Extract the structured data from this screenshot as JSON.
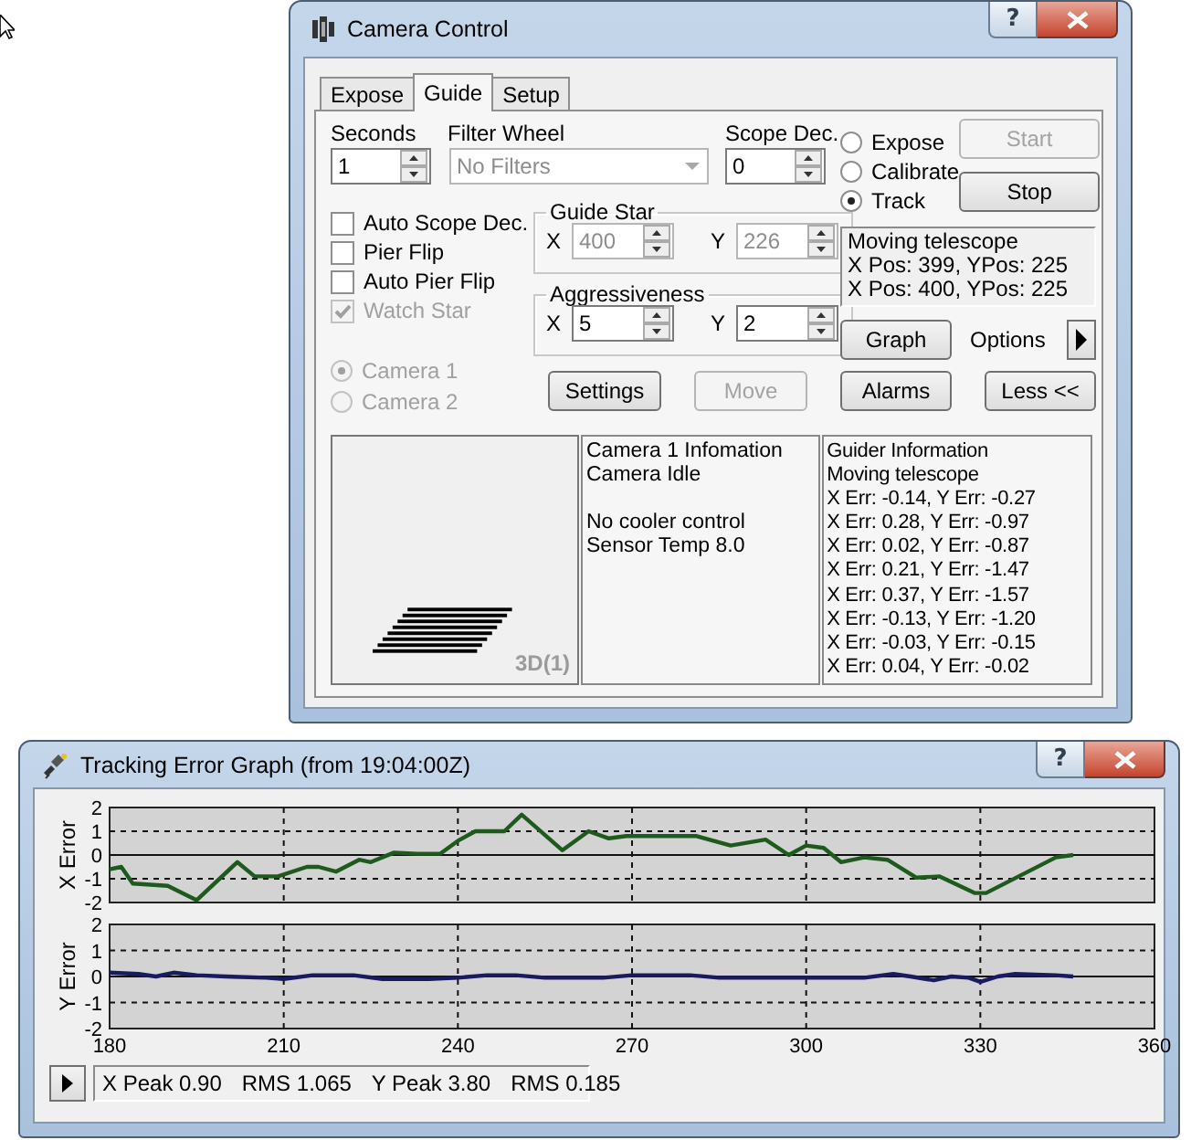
{
  "camera_window": {
    "title": "Camera Control",
    "help_button": "?",
    "tabs": [
      {
        "label": "Expose",
        "selected": false
      },
      {
        "label": "Guide",
        "selected": true
      },
      {
        "label": "Setup",
        "selected": false
      }
    ],
    "seconds": {
      "label": "Seconds",
      "value": "1"
    },
    "filter_wheel": {
      "label": "Filter Wheel",
      "value": "No Filters",
      "disabled": true
    },
    "scope_dec": {
      "label": "Scope Dec.",
      "value": "0"
    },
    "mode_options": [
      {
        "label": "Expose",
        "selected": false
      },
      {
        "label": "Calibrate",
        "selected": false
      },
      {
        "label": "Track",
        "selected": true
      }
    ],
    "start_button": {
      "label": "Start",
      "disabled": true
    },
    "stop_button": {
      "label": "Stop",
      "disabled": false
    },
    "checkboxes": [
      {
        "label": "Auto Scope Dec.",
        "checked": false,
        "disabled": false
      },
      {
        "label": "Pier Flip",
        "checked": false,
        "disabled": false
      },
      {
        "label": "Auto Pier Flip",
        "checked": false,
        "disabled": false
      },
      {
        "label": "Watch Star",
        "checked": true,
        "disabled": true
      }
    ],
    "guide_star": {
      "title": "Guide Star",
      "fields": [
        {
          "label": "X",
          "value": "400",
          "disabled": true
        },
        {
          "label": "Y",
          "value": "226",
          "disabled": true
        }
      ]
    },
    "aggressiveness": {
      "title": "Aggressiveness",
      "fields": [
        {
          "label": "X",
          "value": "5",
          "disabled": false
        },
        {
          "label": "Y",
          "value": "2",
          "disabled": false
        }
      ]
    },
    "status_lines": [
      "Moving telescope",
      "X Pos: 399, YPos: 225",
      "X Pos: 400, YPos: 225"
    ],
    "graph_button": {
      "label": "Graph",
      "disabled": false
    },
    "options_label": "Options",
    "camera_options": [
      {
        "label": "Camera 1",
        "selected": true,
        "disabled": true
      },
      {
        "label": "Camera 2",
        "selected": false,
        "disabled": true
      }
    ],
    "settings_button": {
      "label": "Settings",
      "disabled": false
    },
    "move_button": {
      "label": "Move",
      "disabled": true
    },
    "alarms_button": {
      "label": "Alarms",
      "disabled": false
    },
    "less_button": {
      "label": "Less <<",
      "disabled": false
    },
    "image_panel": {
      "label": "3D(1)"
    },
    "camera_info": [
      [
        "Camera 1 Infomation",
        "Camera Idle"
      ],
      [
        "No cooler control",
        "Sensor Temp 8.0"
      ]
    ],
    "guider_info": [
      "Guider Information",
      "Moving telescope",
      "X Err: -0.14, Y Err: -0.27",
      "X Err: 0.28, Y Err: -0.97",
      "X Err: 0.02, Y Err: -0.87",
      "X Err: 0.21, Y Err: -1.47",
      "X Err: 0.37, Y Err: -1.57",
      "X Err: -0.13, Y Err: -1.20",
      "X Err: -0.03, Y Err: -0.15",
      "X Err: 0.04, Y Err: -0.02"
    ]
  },
  "graph_window": {
    "title": "Tracking Error Graph (from 19:04:00Z)",
    "help_button": "?",
    "charts": [
      {
        "chart_data": {
          "type": "line",
          "ylabel": "X Error",
          "xlim": [
            180,
            360
          ],
          "ylim": [
            -2,
            2
          ],
          "yticks": [
            -2,
            -1,
            0,
            1,
            2
          ],
          "grid": true,
          "x": [
            180,
            182,
            184,
            190,
            195,
            202,
            205,
            209,
            214,
            216,
            219,
            223,
            225,
            229,
            233,
            237,
            240,
            243,
            248,
            251,
            258,
            262.5,
            266,
            269,
            281,
            287,
            293,
            297,
            300,
            303,
            306,
            310,
            314,
            319,
            323,
            329,
            331,
            339,
            343,
            346
          ],
          "series": [
            {
              "color": "#1e5a1e",
              "values": [
                -0.6,
                -0.5,
                -1.2,
                -1.3,
                -1.9,
                -0.3,
                -0.9,
                -0.9,
                -0.5,
                -0.5,
                -0.7,
                -0.2,
                -0.3,
                0.1,
                0.05,
                0.05,
                0.6,
                1.0,
                1.0,
                1.7,
                0.2,
                1.0,
                0.7,
                0.8,
                0.8,
                0.4,
                0.65,
                0.0,
                0.4,
                0.3,
                -0.3,
                -0.1,
                -0.2,
                -0.95,
                -0.9,
                -1.6,
                -1.6,
                -0.6,
                -0.1,
                0.0
              ]
            }
          ]
        }
      },
      {
        "chart_data": {
          "type": "line",
          "ylabel": "Y Error",
          "xlim": [
            180,
            360
          ],
          "ylim": [
            -2,
            2
          ],
          "xticks": [
            180,
            210,
            240,
            270,
            300,
            330,
            360
          ],
          "yticks": [
            -2,
            -1,
            0,
            1,
            2
          ],
          "grid": true,
          "x": [
            180,
            185,
            188,
            191,
            195,
            200,
            207,
            210,
            215,
            222,
            227,
            235,
            240,
            245,
            250,
            255,
            265,
            270,
            280,
            285,
            290,
            300,
            310,
            315,
            318,
            322,
            325,
            328,
            330,
            333,
            336,
            343,
            346
          ],
          "series": [
            {
              "color": "#1a1a5e",
              "values": [
                0.15,
                0.1,
                0.0,
                0.15,
                0.05,
                0.0,
                -0.05,
                -0.1,
                0.05,
                0.05,
                -0.1,
                -0.1,
                -0.05,
                0.05,
                0.05,
                -0.05,
                -0.05,
                0.05,
                0.05,
                -0.05,
                -0.05,
                -0.05,
                -0.05,
                0.1,
                0.0,
                -0.15,
                0.0,
                -0.05,
                -0.2,
                0.0,
                0.1,
                0.05,
                0.0
              ]
            }
          ]
        }
      }
    ],
    "stats": [
      "X Peak 0.90",
      "RMS 1.065",
      "Y Peak 3.80",
      "RMS 0.185"
    ]
  }
}
